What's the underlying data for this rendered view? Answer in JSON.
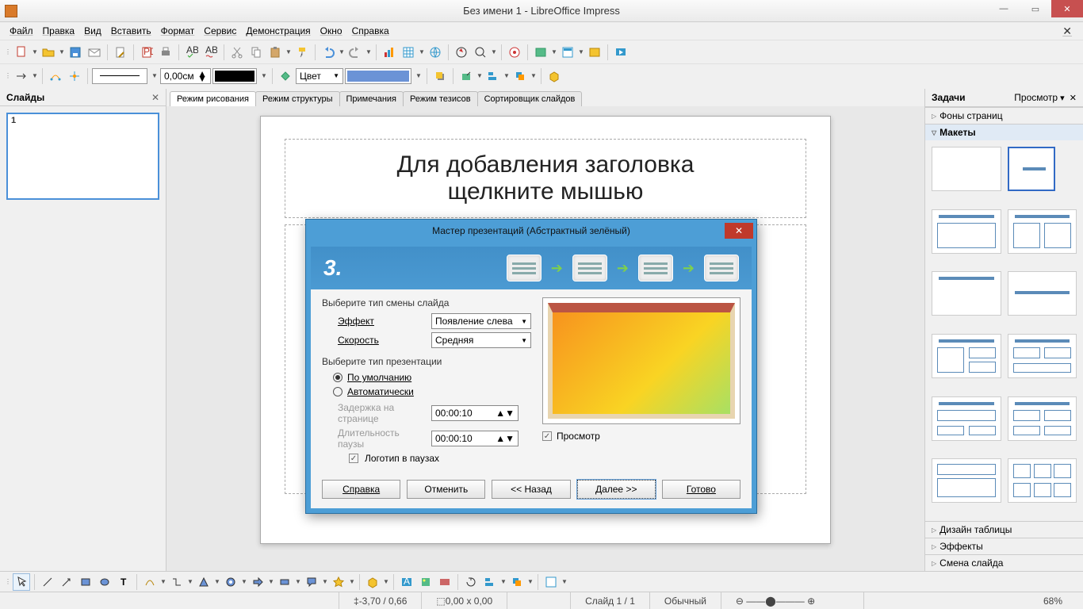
{
  "window": {
    "title": "Без имени 1 - LibreOffice Impress"
  },
  "menubar": [
    "Файл",
    "Правка",
    "Вид",
    "Вставить",
    "Формат",
    "Сервис",
    "Демонстрация",
    "Окно",
    "Справка"
  ],
  "toolbar2": {
    "line_width_value": "0,00см",
    "color_mode": "Цвет"
  },
  "panels": {
    "slides_title": "Слайды",
    "tasks_title": "Задачи",
    "tasks_view": "Просмотр",
    "acc_pages": "Фоны страниц",
    "acc_layouts": "Макеты",
    "acc_table": "Дизайн таблицы",
    "acc_effects": "Эффекты",
    "acc_trans": "Смена слайда"
  },
  "view_tabs": [
    "Режим рисования",
    "Режим структуры",
    "Примечания",
    "Режим тезисов",
    "Сортировщик слайдов"
  ],
  "slide": {
    "title_l1": "Для добавления заголовка",
    "title_l2": "щелкните мышью"
  },
  "wizard": {
    "title": "Мастер презентаций (Абстрактный зелёный)",
    "step": "3.",
    "sec_transition": "Выберите тип смены слайда",
    "lbl_effect": "Эффект",
    "val_effect": "Появление слева",
    "lbl_speed": "Скорость",
    "val_speed": "Средняя",
    "sec_type": "Выберите тип презентации",
    "opt_default": "По умолчанию",
    "opt_auto": "Автоматически",
    "lbl_delay": "Задержка на странице",
    "val_delay": "00:00:10",
    "lbl_pause": "Длительность паузы",
    "val_pause": "00:00:10",
    "chk_logo": "Логотип в паузах",
    "chk_preview": "Просмотр",
    "btn_help": "Справка",
    "btn_cancel": "Отменить",
    "btn_back": "<< Назад",
    "btn_next": "Далее >>",
    "btn_finish": "Готово"
  },
  "status": {
    "coords": "-3,70 / 0,66",
    "size": "0,00 x 0,00",
    "slide": "Слайд 1 / 1",
    "style": "Обычный",
    "zoom": "68%"
  }
}
